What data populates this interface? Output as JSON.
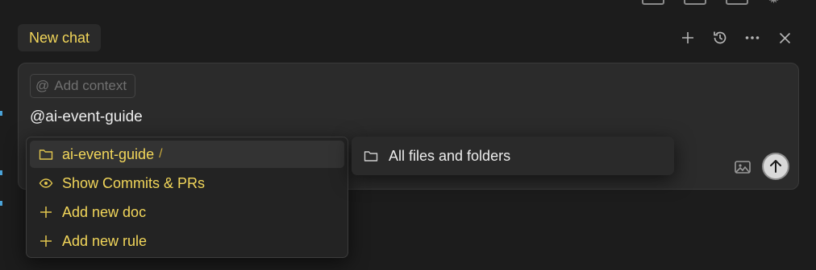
{
  "top_icons": [
    "panel-left-icon",
    "panel-bottom-icon",
    "panel-right-icon",
    "gear-icon"
  ],
  "header": {
    "tab_title": "New chat",
    "actions": [
      "plus-icon",
      "history-icon",
      "more-icon",
      "close-icon"
    ]
  },
  "composer": {
    "add_context_symbol": "@",
    "add_context_label": "Add context",
    "text": "@ai-event-guide"
  },
  "mention_menu": {
    "items": [
      {
        "icon": "folder-icon",
        "label": "ai-event-guide",
        "suffix": "/",
        "selected": true
      },
      {
        "icon": "eye-icon",
        "label": "Show Commits & PRs"
      },
      {
        "icon": "plus-icon",
        "label": "Add new doc"
      },
      {
        "icon": "plus-icon",
        "label": "Add new rule"
      }
    ]
  },
  "submenu": {
    "items": [
      {
        "icon": "folder-icon",
        "label": "All files and folders"
      }
    ]
  },
  "colors": {
    "background": "#1c1c1c",
    "accent_yellow": "#f2d65a",
    "panel": "#2b2b2b"
  }
}
